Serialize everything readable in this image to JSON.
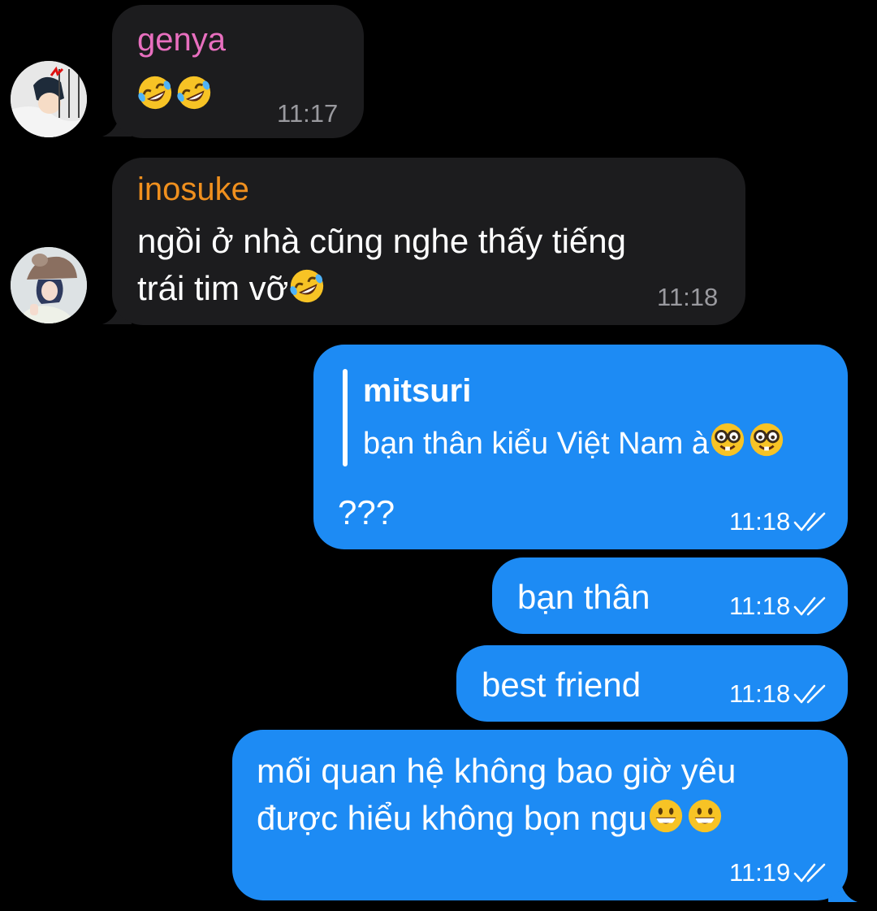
{
  "colors": {
    "background": "#000000",
    "incoming_bubble": "#1c1c1e",
    "outgoing_bubble": "#1d8bf4",
    "genya_name": "#e86fbf",
    "inosuke_name": "#f0901e",
    "incoming_time": "#9a9a9f"
  },
  "messages": [
    {
      "direction": "incoming",
      "sender": "genya",
      "emoji_names": [
        "rolling-on-floor-laughing-emoji",
        "rolling-on-floor-laughing-emoji"
      ],
      "time": "11:17"
    },
    {
      "direction": "incoming",
      "sender": "inosuke",
      "line1": "ngồi ở nhà cũng nghe thấy tiếng",
      "line2": "trái tim vỡ",
      "emoji_names": [
        "rolling-on-floor-laughing-emoji"
      ],
      "time": "11:18"
    },
    {
      "direction": "outgoing",
      "reply": {
        "name": "mitsuri",
        "text": "bạn thân kiểu Việt Nam à",
        "emoji_names": [
          "nerd-face-emoji",
          "nerd-face-emoji"
        ]
      },
      "text": "???",
      "time": "11:18",
      "status_icon": "double-check-icon"
    },
    {
      "direction": "outgoing",
      "text": "bạn thân",
      "time": "11:18",
      "status_icon": "double-check-icon"
    },
    {
      "direction": "outgoing",
      "text": "best friend",
      "time": "11:18",
      "status_icon": "double-check-icon"
    },
    {
      "direction": "outgoing",
      "line1": "mối quan hệ không bao giờ yêu",
      "line2": "được hiểu không bọn ngu",
      "emoji_names": [
        "grinning-face-emoji",
        "grinning-face-emoji"
      ],
      "time": "11:19",
      "status_icon": "double-check-icon"
    }
  ]
}
